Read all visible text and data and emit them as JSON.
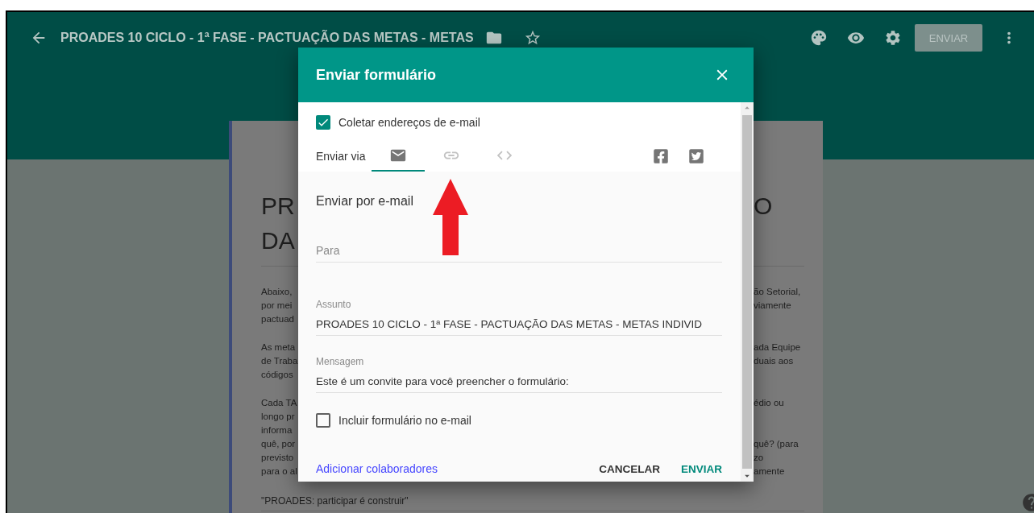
{
  "top_bar": {
    "title": "PROADES 10 CICLO - 1ª FASE - PACTUAÇÃO DAS METAS - METAS",
    "send_button": "ENVIAR"
  },
  "form_card": {
    "title_rows": [
      {
        "left": "PR",
        "right": "O"
      },
      {
        "left": "DA"
      }
    ],
    "paragraphs": [
      [
        {
          "left": "Abaixo,",
          "right": "ão Setorial,"
        },
        {
          "left": "por mei",
          "right": "viamente"
        },
        {
          "left": "pactuad"
        }
      ],
      [
        {
          "left": "As meta",
          "right": "ada Equipe"
        },
        {
          "left": "de Traba",
          "right": "duais aos"
        },
        {
          "left": "códigos"
        }
      ],
      [
        {
          "left": "Cada TA",
          "right": "édio ou"
        },
        {
          "left": "longo pr"
        },
        {
          "left": "informa"
        },
        {
          "left": "quê, por",
          "right": "quê? (para"
        },
        {
          "left": "previsto",
          "right": "zo"
        },
        {
          "left": "para o al",
          "right": "amente"
        }
      ]
    ],
    "quote": "\"PROADES: participar é construir\""
  },
  "dialog": {
    "title": "Enviar formulário",
    "collect_emails": {
      "label": "Coletar endereços de e-mail",
      "checked": true
    },
    "send_via": {
      "label": "Enviar via",
      "tabs": [
        {
          "kind": "email",
          "selected": true
        },
        {
          "kind": "link",
          "selected": false
        },
        {
          "kind": "embed",
          "selected": false
        }
      ],
      "share": [
        {
          "kind": "facebook"
        },
        {
          "kind": "twitter"
        }
      ]
    },
    "section_title": "Enviar por e-mail",
    "fields": [
      {
        "placeholder": "Para"
      },
      {
        "label": "Assunto",
        "value": "PROADES 10 CICLO - 1ª FASE - PACTUAÇÃO DAS METAS - METAS INDIVID"
      },
      {
        "label": "Mensagem",
        "value": "Este é um convite para você preencher o formulário:"
      }
    ],
    "include_form": {
      "label": "Incluir formulário no e-mail",
      "checked": false
    },
    "add_collaborators": "Adicionar colaboradores",
    "buttons": [
      {
        "kind": "cancel",
        "label": "CANCELAR"
      },
      {
        "kind": "send",
        "label": "ENVIAR"
      }
    ]
  }
}
